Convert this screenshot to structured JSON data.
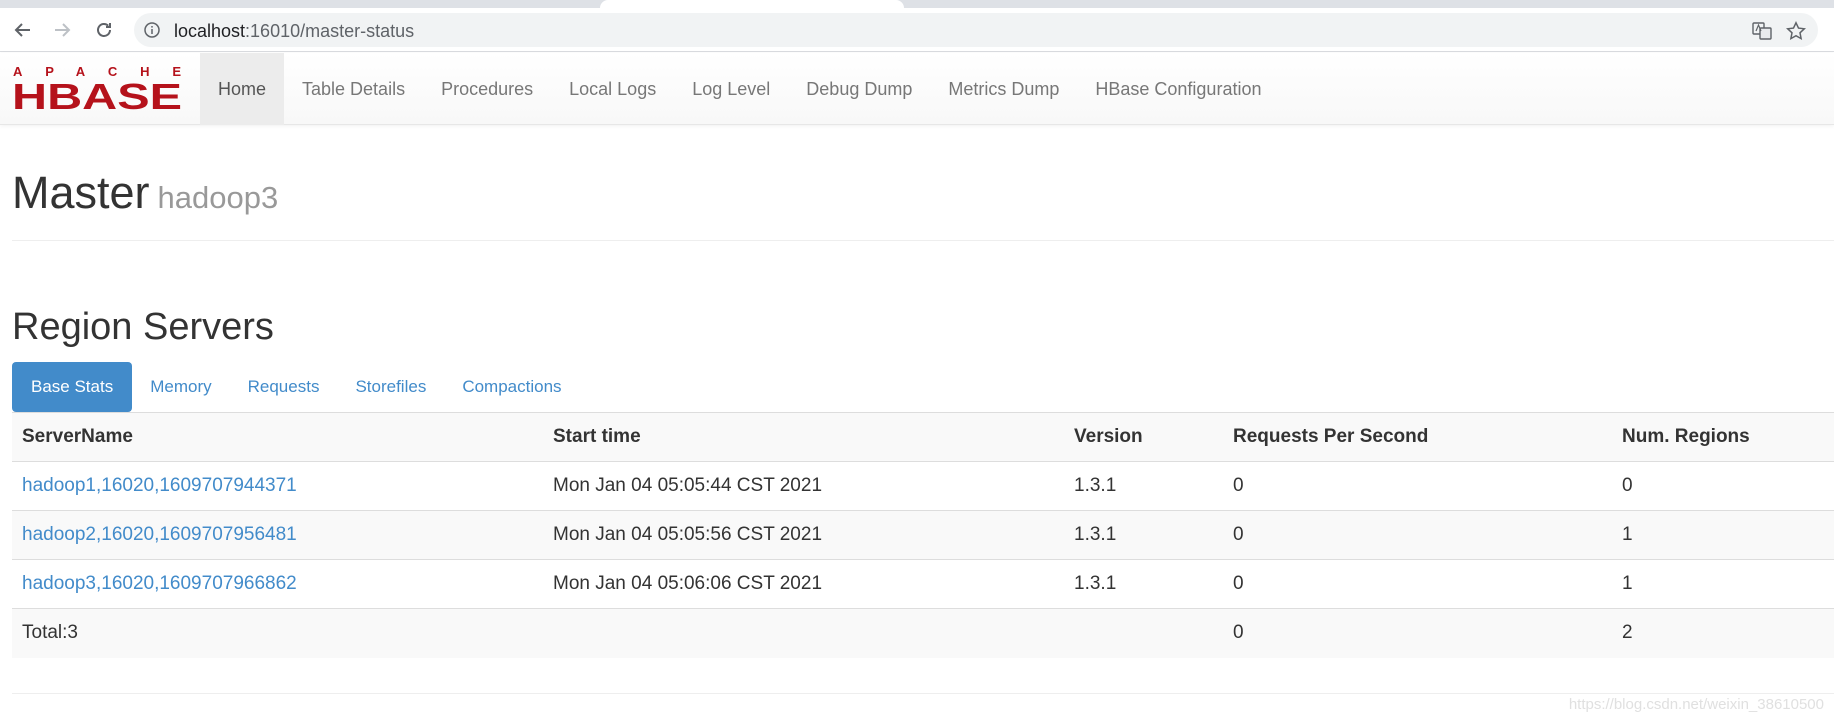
{
  "browser": {
    "url_host": "localhost",
    "url_rest": ":16010/master-status"
  },
  "navbar": {
    "logo_top": "APACHE",
    "logo_main": "HBASE",
    "items": [
      {
        "label": "Home"
      },
      {
        "label": "Table Details"
      },
      {
        "label": "Procedures"
      },
      {
        "label": "Local Logs"
      },
      {
        "label": "Log Level"
      },
      {
        "label": "Debug Dump"
      },
      {
        "label": "Metrics Dump"
      },
      {
        "label": "HBase Configuration"
      }
    ]
  },
  "header": {
    "title": "Master",
    "subtitle": "hadoop3"
  },
  "region_servers": {
    "title": "Region Servers",
    "tabs": [
      {
        "label": "Base Stats"
      },
      {
        "label": "Memory"
      },
      {
        "label": "Requests"
      },
      {
        "label": "Storefiles"
      },
      {
        "label": "Compactions"
      }
    ],
    "columns": [
      "ServerName",
      "Start time",
      "Version",
      "Requests Per Second",
      "Num. Regions"
    ],
    "rows": [
      {
        "server": "hadoop1,16020,1609707944371",
        "start": "Mon Jan 04 05:05:44 CST 2021",
        "version": "1.3.1",
        "rps": "0",
        "regions": "0"
      },
      {
        "server": "hadoop2,16020,1609707956481",
        "start": "Mon Jan 04 05:05:56 CST 2021",
        "version": "1.3.1",
        "rps": "0",
        "regions": "1"
      },
      {
        "server": "hadoop3,16020,1609707966862",
        "start": "Mon Jan 04 05:06:06 CST 2021",
        "version": "1.3.1",
        "rps": "0",
        "regions": "1"
      }
    ],
    "total": {
      "label": "Total:3",
      "rps": "0",
      "regions": "2"
    }
  },
  "watermark": "https://blog.csdn.net/weixin_38610500",
  "colors": {
    "link": "#428bca",
    "logo_red": "#b5121b"
  }
}
